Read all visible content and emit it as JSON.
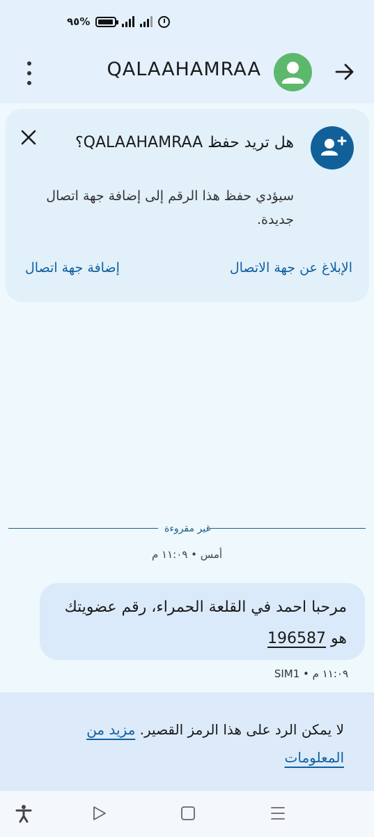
{
  "status_bar": {
    "battery_percent": "%٩٥",
    "battery_level": 0.95,
    "icons": [
      "battery-icon",
      "signal-icon",
      "signal-icon",
      "alarm-icon"
    ]
  },
  "app_bar": {
    "contact_name": "QALAAHAMRAA",
    "icons": [
      "more-vert-icon",
      "avatar-person-icon",
      "back-arrow-icon"
    ]
  },
  "save_prompt": {
    "title": "هل تريد حفظ QALAAHAMRAA؟",
    "description": "سيؤدي حفظ هذا الرقم إلى إضافة جهة اتصال جديدة.",
    "report_label": "الإبلاغ عن جهة الاتصال",
    "add_label": "إضافة جهة اتصال",
    "icons": [
      "person-add-icon",
      "close-icon"
    ]
  },
  "conversation": {
    "unread_label": "غير مقروءة",
    "timestamp": "أمس • ١١:٠٩ م",
    "message": {
      "text_before": "مرحبا احمد في القلعة الحمراء، رقم عضويتك هو ",
      "number": "196587",
      "meta": "١١:٠٩ م • SIM1"
    }
  },
  "reply_bar": {
    "text": "لا يمكن الرد على هذا الرمز القصير. ",
    "link": "مزيد من المعلومات"
  },
  "nav_bar": {
    "icons": [
      "accessibility-icon",
      "back-triangle-icon",
      "home-square-icon",
      "recents-icon"
    ]
  },
  "colors": {
    "background": "#eef8fd",
    "card": "#e2f0fa",
    "bubble": "#dbeafa",
    "accent": "#1160a0",
    "avatar": "#5cb86d"
  }
}
